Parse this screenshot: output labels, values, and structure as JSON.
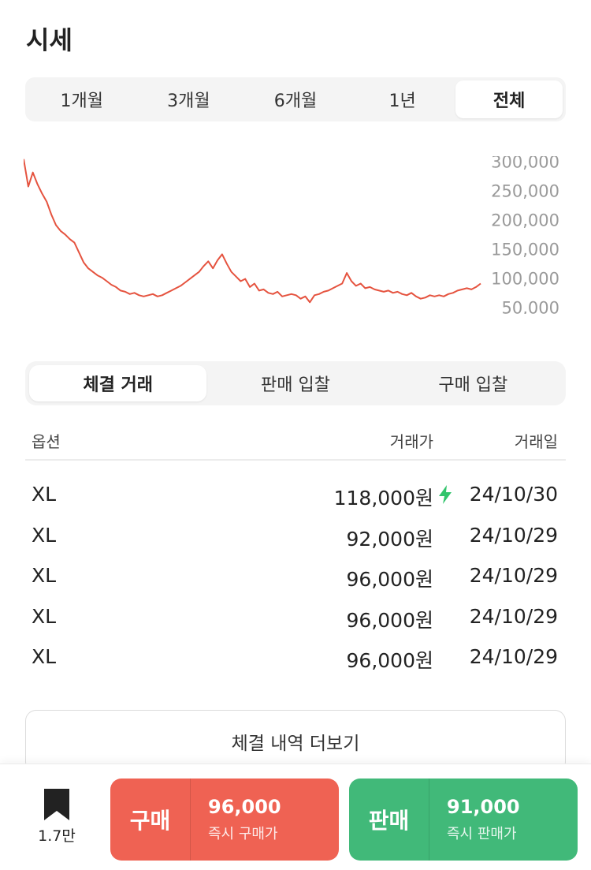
{
  "title": "시세",
  "period_tabs": [
    "1개월",
    "3개월",
    "6개월",
    "1년",
    "전체"
  ],
  "period_active": "전체",
  "chart_data": {
    "type": "line",
    "title": "",
    "xlabel": "",
    "ylabel": "",
    "ylim": [
      40000,
      310000
    ],
    "yticks": [
      "300,000",
      "250,000",
      "200,000",
      "150,000",
      "100,000",
      "50,000"
    ],
    "ytick_values": [
      300000,
      250000,
      200000,
      150000,
      100000,
      50000
    ],
    "grid": false,
    "line_color": "#e5533f",
    "series": [
      {
        "values": [
          305000,
          258000,
          282000,
          262000,
          246000,
          232000,
          210000,
          192000,
          182000,
          176000,
          168000,
          162000,
          145000,
          128000,
          118000,
          112000,
          106000,
          102000,
          96000,
          90000,
          86000,
          80000,
          78000,
          74000,
          76000,
          72000,
          70000,
          72000,
          74000,
          70000,
          72000,
          76000,
          80000,
          84000,
          88000,
          94000,
          100000,
          106000,
          112000,
          122000,
          130000,
          118000,
          132000,
          142000,
          126000,
          112000,
          104000,
          96000,
          100000,
          86000,
          92000,
          80000,
          82000,
          76000,
          74000,
          78000,
          70000,
          72000,
          74000,
          72000,
          66000,
          70000,
          60000,
          72000,
          74000,
          78000,
          80000,
          84000,
          88000,
          92000,
          110000,
          96000,
          88000,
          92000,
          84000,
          86000,
          82000,
          80000,
          78000,
          80000,
          76000,
          78000,
          74000,
          72000,
          76000,
          70000,
          66000,
          68000,
          72000,
          70000,
          72000,
          70000,
          74000,
          76000,
          80000,
          82000,
          84000,
          82000,
          86000,
          92000
        ]
      }
    ]
  },
  "trade_tabs": [
    "체결 거래",
    "판매 입찰",
    "구매 입찰"
  ],
  "trade_active": "체결 거래",
  "table": {
    "headers": {
      "option": "옵션",
      "price": "거래가",
      "date": "거래일"
    },
    "rows": [
      {
        "option": "XL",
        "price": "118,000원",
        "date": "24/10/30",
        "flash": true
      },
      {
        "option": "XL",
        "price": "92,000원",
        "date": "24/10/29",
        "flash": false
      },
      {
        "option": "XL",
        "price": "96,000원",
        "date": "24/10/29",
        "flash": false
      },
      {
        "option": "XL",
        "price": "96,000원",
        "date": "24/10/29",
        "flash": false
      },
      {
        "option": "XL",
        "price": "96,000원",
        "date": "24/10/29",
        "flash": false
      }
    ]
  },
  "more_button": "체결 내역 더보기",
  "bookmark": {
    "icon": "bookmark-icon",
    "count": "1.7만"
  },
  "buy": {
    "label": "구매",
    "price": "96,000",
    "sub": "즉시 구매가",
    "color": "#ef6253"
  },
  "sell": {
    "label": "판매",
    "price": "91,000",
    "sub": "즉시 판매가",
    "color": "#41b979"
  },
  "flash_color": "#31c46b"
}
